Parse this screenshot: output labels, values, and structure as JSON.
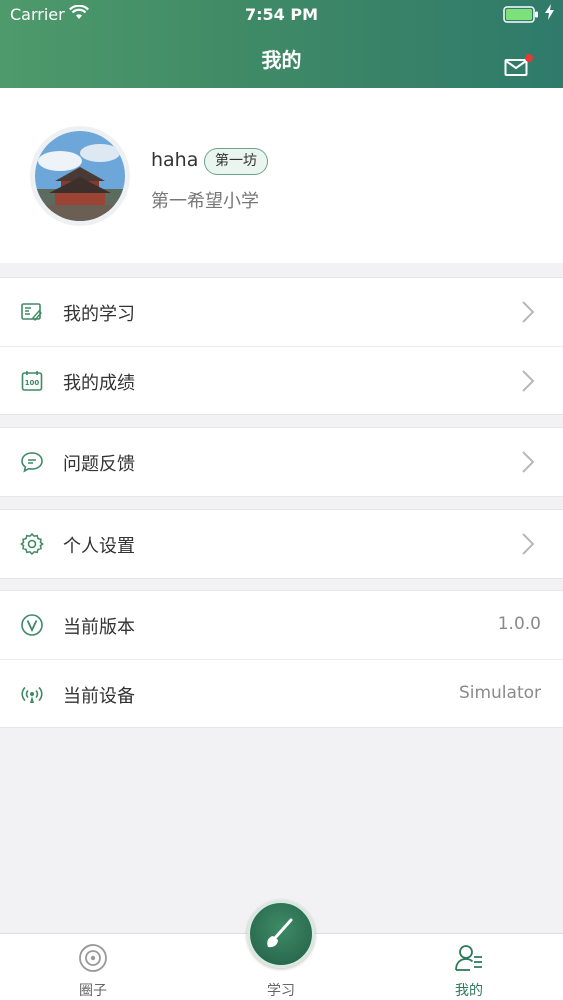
{
  "status_bar": {
    "carrier": "Carrier",
    "time": "7:54 PM"
  },
  "header": {
    "title": "我的"
  },
  "profile": {
    "username": "haha",
    "badge": "第一坊",
    "school": "第一希望小学"
  },
  "menu": {
    "my_study": "我的学习",
    "my_scores": "我的成绩",
    "feedback": "问题反馈",
    "settings": "个人设置",
    "version_label": "当前版本",
    "version_value": "1.0.0",
    "device_label": "当前设备",
    "device_value": "Simulator"
  },
  "tabbar": {
    "circle": "圈子",
    "study": "学习",
    "mine": "我的"
  },
  "colors": {
    "brand_green": "#3f8a66",
    "active_tab": "#2f7a5a",
    "notification_dot": "#e53935"
  }
}
